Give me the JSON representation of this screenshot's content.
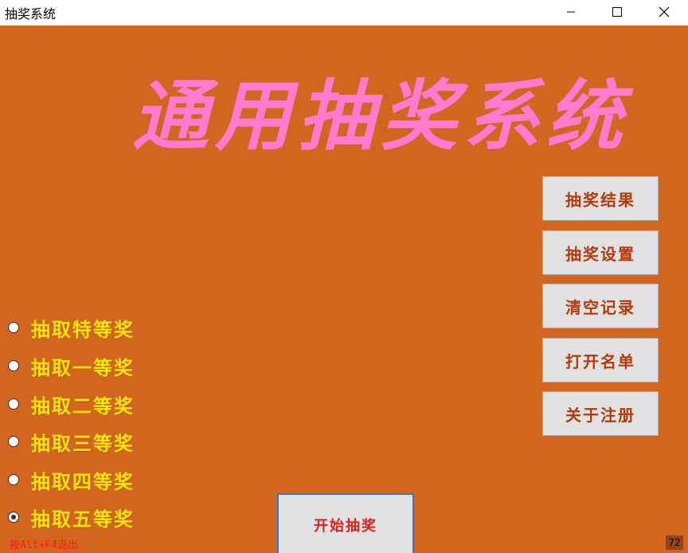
{
  "window": {
    "title": "抽奖系统"
  },
  "main": {
    "heading": "通用抽奖系统"
  },
  "side_buttons": [
    {
      "label": "抽奖结果"
    },
    {
      "label": "抽奖设置"
    },
    {
      "label": "清空记录"
    },
    {
      "label": "打开名单"
    },
    {
      "label": "关于注册"
    }
  ],
  "prize_options": [
    {
      "label": "抽取特等奖",
      "selected": false
    },
    {
      "label": "抽取一等奖",
      "selected": false
    },
    {
      "label": "抽取二等奖",
      "selected": false
    },
    {
      "label": "抽取三等奖",
      "selected": false
    },
    {
      "label": "抽取四等奖",
      "selected": false
    },
    {
      "label": "抽取五等奖",
      "selected": true
    }
  ],
  "start_button": {
    "label": "开始抽奖"
  },
  "footer": {
    "exit_hint": "按Alt+F4退出",
    "counter": "72"
  },
  "icons": {
    "minimize": "minimize-icon",
    "maximize": "maximize-icon",
    "close": "close-icon"
  },
  "colors": {
    "background": "#d2661f",
    "heading": "#ff7bd0",
    "radio_label": "#ffe600",
    "side_button_text": "#b33a0a",
    "start_button_text": "#e02020",
    "exit_hint": "#ff1a1a"
  }
}
